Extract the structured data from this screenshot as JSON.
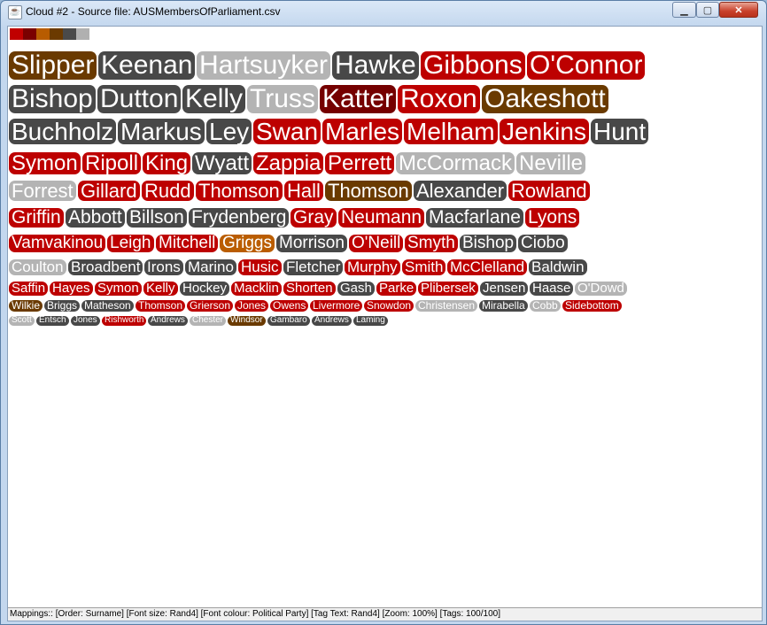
{
  "window": {
    "title": "Cloud #2 - Source file: AUSMembersOfParliament.csv"
  },
  "legend": {
    "colors": [
      "#c00000",
      "#7a0000",
      "#b85c00",
      "#6b3a00",
      "#4a4a4a",
      "#b0b0b0"
    ]
  },
  "palette": {
    "R": "#bd0000",
    "D": "#750000",
    "O": "#ba5d00",
    "B": "#6a3a00",
    "G": "#484848",
    "L": "#b4b4b4"
  },
  "cloud": {
    "rows": [
      [
        {
          "text": "Slipper",
          "c": "B"
        },
        {
          "text": "Keenan",
          "c": "G"
        },
        {
          "text": "Hartsuyker",
          "c": "L"
        },
        {
          "text": "Hawke",
          "c": "G"
        },
        {
          "text": "Gibbons",
          "c": "R"
        },
        {
          "text": "O'Connor",
          "c": "R"
        }
      ],
      [
        {
          "text": "Bishop",
          "c": "G"
        },
        {
          "text": "Dutton",
          "c": "G"
        },
        {
          "text": "Kelly",
          "c": "G"
        },
        {
          "text": "Truss",
          "c": "L"
        },
        {
          "text": "Katter",
          "c": "D"
        },
        {
          "text": "Roxon",
          "c": "R"
        },
        {
          "text": "Oakeshott",
          "c": "B"
        }
      ],
      [
        {
          "text": "Buchholz",
          "c": "G"
        },
        {
          "text": "Markus",
          "c": "G"
        },
        {
          "text": "Ley",
          "c": "G"
        },
        {
          "text": "Swan",
          "c": "R"
        },
        {
          "text": "Marles",
          "c": "R"
        },
        {
          "text": "Melham",
          "c": "R"
        },
        {
          "text": "Jenkins",
          "c": "R"
        },
        {
          "text": "Hunt",
          "c": "G"
        }
      ],
      [
        {
          "text": "Symon",
          "c": "R"
        },
        {
          "text": "Ripoll",
          "c": "R"
        },
        {
          "text": "King",
          "c": "R"
        },
        {
          "text": "Wyatt",
          "c": "G"
        },
        {
          "text": "Zappia",
          "c": "R"
        },
        {
          "text": "Perrett",
          "c": "R"
        },
        {
          "text": "McCormack",
          "c": "L"
        },
        {
          "text": "Neville",
          "c": "L"
        }
      ],
      [
        {
          "text": "Forrest",
          "c": "L"
        },
        {
          "text": "Gillard",
          "c": "R"
        },
        {
          "text": "Rudd",
          "c": "R"
        },
        {
          "text": "Thomson",
          "c": "R"
        },
        {
          "text": "Hall",
          "c": "R"
        },
        {
          "text": "Thomson",
          "c": "B"
        },
        {
          "text": "Alexander",
          "c": "G"
        },
        {
          "text": "Rowland",
          "c": "R"
        }
      ],
      [
        {
          "text": "Griffin",
          "c": "R"
        },
        {
          "text": "Abbott",
          "c": "G"
        },
        {
          "text": "Billson",
          "c": "G"
        },
        {
          "text": "Frydenberg",
          "c": "G"
        },
        {
          "text": "Gray",
          "c": "R"
        },
        {
          "text": "Neumann",
          "c": "R"
        },
        {
          "text": "Macfarlane",
          "c": "G"
        },
        {
          "text": "Lyons",
          "c": "R"
        }
      ],
      [
        {
          "text": "Vamvakinou",
          "c": "R"
        },
        {
          "text": "Leigh",
          "c": "R"
        },
        {
          "text": "Mitchell",
          "c": "R"
        },
        {
          "text": "Griggs",
          "c": "O"
        },
        {
          "text": "Morrison",
          "c": "G"
        },
        {
          "text": "O'Neill",
          "c": "R"
        },
        {
          "text": "Smyth",
          "c": "R"
        },
        {
          "text": "Bishop",
          "c": "G"
        },
        {
          "text": "Ciobo",
          "c": "G"
        }
      ],
      [
        {
          "text": "Coulton",
          "c": "L"
        },
        {
          "text": "Broadbent",
          "c": "G"
        },
        {
          "text": "Irons",
          "c": "G"
        },
        {
          "text": "Marino",
          "c": "G"
        },
        {
          "text": "Husic",
          "c": "R"
        },
        {
          "text": "Fletcher",
          "c": "G"
        },
        {
          "text": "Murphy",
          "c": "R"
        },
        {
          "text": "Smith",
          "c": "R"
        },
        {
          "text": "McClelland",
          "c": "R"
        },
        {
          "text": "Baldwin",
          "c": "G"
        }
      ],
      [
        {
          "text": "Saffin",
          "c": "R"
        },
        {
          "text": "Hayes",
          "c": "R"
        },
        {
          "text": "Symon",
          "c": "R"
        },
        {
          "text": "Kelly",
          "c": "R"
        },
        {
          "text": "Hockey",
          "c": "G"
        },
        {
          "text": "Macklin",
          "c": "R"
        },
        {
          "text": "Shorten",
          "c": "R"
        },
        {
          "text": "Gash",
          "c": "G"
        },
        {
          "text": "Parke",
          "c": "R"
        },
        {
          "text": "Plibersek",
          "c": "R"
        },
        {
          "text": "Jensen",
          "c": "G"
        },
        {
          "text": "Haase",
          "c": "G"
        },
        {
          "text": "O'Dowd",
          "c": "L"
        }
      ],
      [
        {
          "text": "Wilkie",
          "c": "B"
        },
        {
          "text": "Briggs",
          "c": "G"
        },
        {
          "text": "Matheson",
          "c": "G"
        },
        {
          "text": "Thomson",
          "c": "R"
        },
        {
          "text": "Grierson",
          "c": "R"
        },
        {
          "text": "Jones",
          "c": "R"
        },
        {
          "text": "Owens",
          "c": "R"
        },
        {
          "text": "Livermore",
          "c": "R"
        },
        {
          "text": "Snowdon",
          "c": "R"
        },
        {
          "text": "Christensen",
          "c": "L"
        },
        {
          "text": "Mirabella",
          "c": "G"
        },
        {
          "text": "Cobb",
          "c": "L"
        },
        {
          "text": "Sidebottom",
          "c": "R"
        }
      ],
      [
        {
          "text": "Scott",
          "c": "L"
        },
        {
          "text": "Entsch",
          "c": "G"
        },
        {
          "text": "Jones",
          "c": "G"
        },
        {
          "text": "Rishworth",
          "c": "R"
        },
        {
          "text": "Andrews",
          "c": "G"
        },
        {
          "text": "Chester",
          "c": "L"
        },
        {
          "text": "Windsor",
          "c": "B"
        },
        {
          "text": "Gambaro",
          "c": "G"
        },
        {
          "text": "Andrews",
          "c": "G"
        },
        {
          "text": "Laming",
          "c": "G"
        }
      ]
    ]
  },
  "status": {
    "text": "Mappings:: [Order: Surname]  [Font size: Rand4]  [Font colour: Political Party]  [Tag Text: Rand4]  [Zoom: 100%]  [Tags: 100/100]"
  }
}
